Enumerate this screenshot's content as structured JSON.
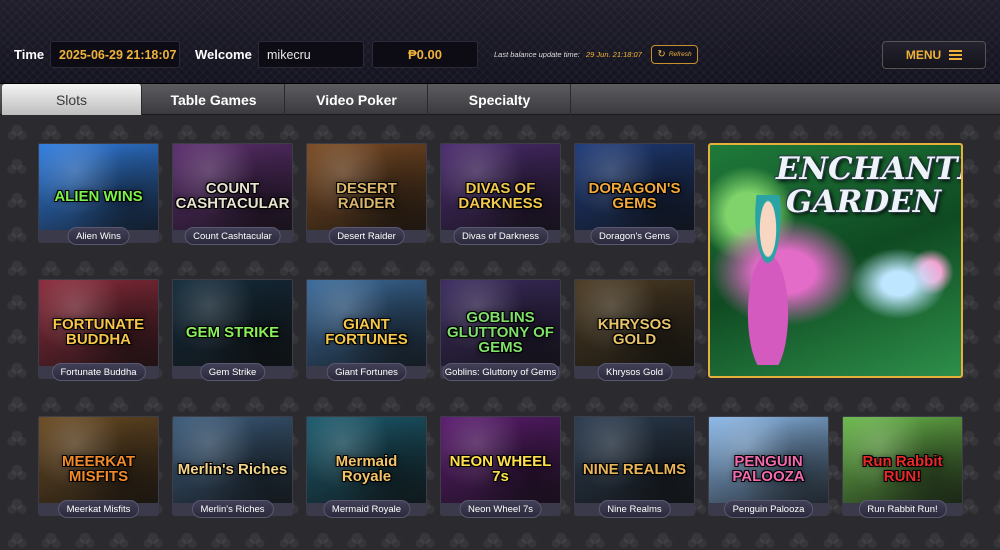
{
  "header": {
    "time_label": "Time",
    "time_value": "2025-06-29 21:18:07",
    "welcome_label": "Welcome",
    "username": "mikecru",
    "balance": "₱0.00",
    "last_update_label": "Last balance update time:",
    "last_update_time": "29 Jun. 21:18:07",
    "refresh_label": "Refresh",
    "menu_label": "MENU"
  },
  "tabs": [
    {
      "label": "Slots",
      "active": true
    },
    {
      "label": "Table Games",
      "active": false
    },
    {
      "label": "Video Poker",
      "active": false
    },
    {
      "label": "Specialty",
      "active": false
    }
  ],
  "games": [
    {
      "name": "Alien Wins",
      "thumb_text": "ALIEN WINS",
      "thumb_color": "#2f7de1",
      "text_color": "#7cf24a"
    },
    {
      "name": "Count Cashtacular",
      "thumb_text": "COUNT CASHTACULAR",
      "thumb_color": "#5b2d6e",
      "text_color": "#e8e2d0"
    },
    {
      "name": "Desert Raider",
      "thumb_text": "DESERT RAIDER",
      "thumb_color": "#7a4a22",
      "text_color": "#d9b46a"
    },
    {
      "name": "Divas of Darkness",
      "thumb_text": "DIVAS OF DARKNESS",
      "thumb_color": "#4a2a6e",
      "text_color": "#f2c94c"
    },
    {
      "name": "Doragon's Gems",
      "thumb_text": "DORAGON'S GEMS",
      "thumb_color": "#1d3a78",
      "text_color": "#f2a93c"
    },
    {
      "name": "Fortunate Buddha",
      "thumb_text": "FORTUNATE BUDDHA",
      "thumb_color": "#8a2a3a",
      "text_color": "#f7c548"
    },
    {
      "name": "Gem Strike",
      "thumb_text": "GEM STRIKE",
      "thumb_color": "#132a3a",
      "text_color": "#8af05a"
    },
    {
      "name": "Giant Fortunes",
      "thumb_text": "GIANT FORTUNES",
      "thumb_color": "#3a6a9a",
      "text_color": "#f5c84a"
    },
    {
      "name": "Goblins: Gluttony of Gems",
      "thumb_text": "GOBLINS GLUTTONY OF GEMS",
      "thumb_color": "#3a2a5e",
      "text_color": "#7fe06a"
    },
    {
      "name": "Khrysos Gold",
      "thumb_text": "KHRYSOS GOLD",
      "thumb_color": "#4a3a22",
      "text_color": "#e8c36a"
    },
    {
      "name": "Meerkat Misfits",
      "thumb_text": "MEERKAT MISFITS",
      "thumb_color": "#6a4a22",
      "text_color": "#f28a2a"
    },
    {
      "name": "Merlin's Riches",
      "thumb_text": "Merlin's Riches",
      "thumb_color": "#3a5a7a",
      "text_color": "#f2d48a"
    },
    {
      "name": "Mermaid Royale",
      "thumb_text": "Mermaid Royale",
      "thumb_color": "#1a5a6e",
      "text_color": "#f2c46a"
    },
    {
      "name": "Neon Wheel 7s",
      "thumb_text": "NEON WHEEL 7s",
      "thumb_color": "#5a1a6e",
      "text_color": "#ffe04a"
    },
    {
      "name": "Nine Realms",
      "thumb_text": "NINE REALMS",
      "thumb_color": "#2a3a4e",
      "text_color": "#e8b45a"
    },
    {
      "name": "Penguin Palooza",
      "thumb_text": "PENGUIN PALOOZA",
      "thumb_color": "#8ab8e8",
      "text_color": "#f26ab0"
    },
    {
      "name": "Run Rabbit Run!",
      "thumb_text": "Run Rabbit RUN!",
      "thumb_color": "#6ab84a",
      "text_color": "#e82a2a"
    }
  ],
  "featured": {
    "title": "ENCHANTED GARDEN",
    "border_color": "#e6b13b"
  }
}
